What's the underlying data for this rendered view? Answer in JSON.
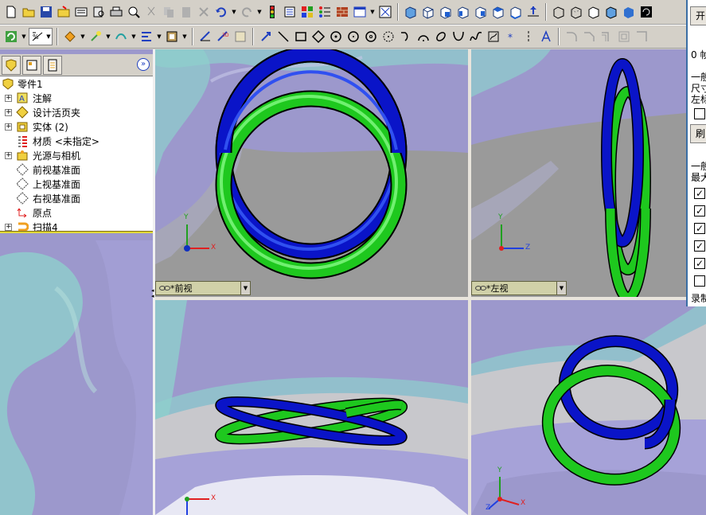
{
  "toolbar_top": {
    "icons": [
      "new-icon",
      "open-icon",
      "save-icon",
      "open-folder-icon",
      "print-icon",
      "print-preview-icon",
      "cut-icon",
      "copy-icon",
      "paste-icon",
      "delete-icon",
      "undo-icon",
      "redo-icon",
      "traffic-light-icon",
      "options-icon",
      "grid-icon",
      "list-icon",
      "brick-icon",
      "window-icon",
      "zoom-fit-icon",
      "standard-views-icon",
      "view-orientation-icon",
      "isometric-icon",
      "trimetric-icon",
      "dimetric-icon",
      "normal-to-icon",
      "wireframe-icon",
      "hidden-lines-icon",
      "shaded-icon",
      "rotate-icon"
    ]
  },
  "toolbar_sketch": {
    "icons": [
      "sketch-icon",
      "smart-dimension-icon",
      "line-icon",
      "rectangle-icon",
      "parallelogram-icon",
      "circle-icon",
      "centerpoint-arc-icon",
      "tangent-arc-icon",
      "three-point-arc-icon",
      "spline-icon",
      "ellipse-icon",
      "centerline-icon",
      "point-icon",
      "text-icon",
      "trim-icon",
      "extend-icon",
      "offset-icon"
    ]
  },
  "feature_tree": {
    "root": "零件1",
    "items": [
      {
        "label": "注解",
        "icon": "annotation-icon",
        "expandable": true
      },
      {
        "label": "设计活页夹",
        "icon": "design-binder-icon",
        "expandable": true
      },
      {
        "label": "实体 (2)",
        "icon": "solid-bodies-icon",
        "expandable": true
      },
      {
        "label": "材质 <未指定>",
        "icon": "material-icon",
        "expandable": false
      },
      {
        "label": "光源与相机",
        "icon": "lights-camera-icon",
        "expandable": true
      },
      {
        "label": "前视基准面",
        "icon": "plane-icon",
        "expandable": false
      },
      {
        "label": "上视基准面",
        "icon": "plane-icon",
        "expandable": false
      },
      {
        "label": "右视基准面",
        "icon": "plane-icon",
        "expandable": false
      },
      {
        "label": "原点",
        "icon": "origin-icon",
        "expandable": false
      },
      {
        "label": "扫描4",
        "icon": "sweep-icon",
        "expandable": true
      }
    ]
  },
  "viewports": {
    "front_label": "*前视",
    "left_label": "*左视",
    "axis_x": "X",
    "axis_y": "Y",
    "axis_z": "Z"
  },
  "colors": {
    "ring_blue": "#0a14c8",
    "ring_green": "#1ec81e",
    "vp_bg": "#9c98cc",
    "vp_grey": "#9a9a9a",
    "vp_cyan": "#8ed0cc"
  },
  "right_panel": {
    "title": "开",
    "line1": "0 帧",
    "line2": "一般",
    "line3": "尺寸",
    "line4": "左标",
    "btn": "刷",
    "line5": "一般",
    "line6": "最大",
    "checks": [
      true,
      true,
      true,
      true,
      true,
      false
    ],
    "line7": "录制"
  }
}
